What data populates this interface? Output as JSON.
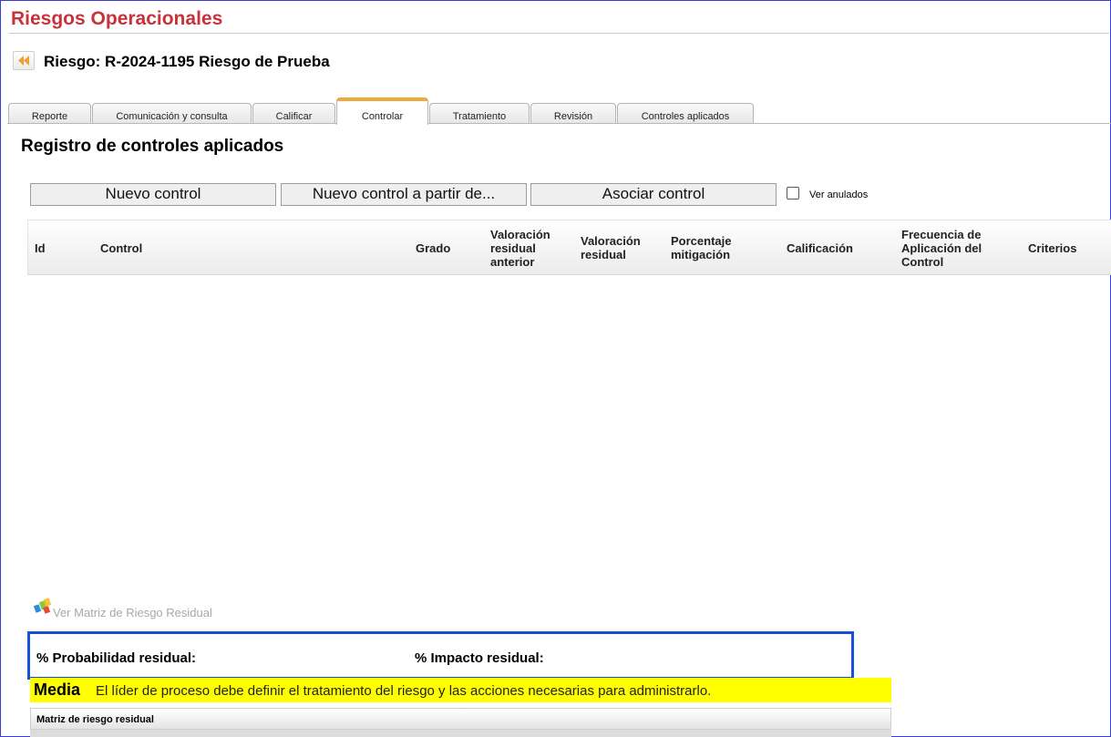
{
  "app": {
    "title": "Riesgos Operacionales"
  },
  "risk": {
    "title": "Riesgo: R-2024-1195 Riesgo de Prueba"
  },
  "tabs": [
    {
      "label": "Reporte"
    },
    {
      "label": "Comunicación y consulta"
    },
    {
      "label": "Calificar"
    },
    {
      "label": "Controlar",
      "active": true
    },
    {
      "label": "Tratamiento"
    },
    {
      "label": "Revisión"
    },
    {
      "label": "Controles aplicados"
    }
  ],
  "section": {
    "title": "Registro de controles aplicados"
  },
  "actions": {
    "new_control": "Nuevo control",
    "new_control_from": "Nuevo control a partir de...",
    "associate_control": "Asociar control",
    "show_voided_label": "Ver anulados",
    "show_voided_checked": false
  },
  "table": {
    "columns": [
      "Id",
      "Control",
      "Grado",
      "Valoración residual anterior",
      "Valoración residual",
      "Porcentaje mitigación",
      "Calificación",
      "Frecuencia de Aplicación del Control",
      "Criterios"
    ],
    "rows": []
  },
  "matrix_link": {
    "label": "Ver Matriz de Riesgo Residual"
  },
  "residual": {
    "probability_label": "% Probabilidad residual:",
    "impact_label": "% Impacto residual:"
  },
  "risk_level": {
    "level": "Media",
    "message": "El líder de proceso debe definir el tratamiento del riesgo y las acciones necesarias para administrarlo.",
    "color": "#ffff00"
  },
  "matrix": {
    "header": "Matriz de riesgo residual"
  },
  "colors": {
    "title_red": "#c8323a",
    "tab_active_accent": "#f2a93b",
    "highlight_border": "#1550d8"
  }
}
